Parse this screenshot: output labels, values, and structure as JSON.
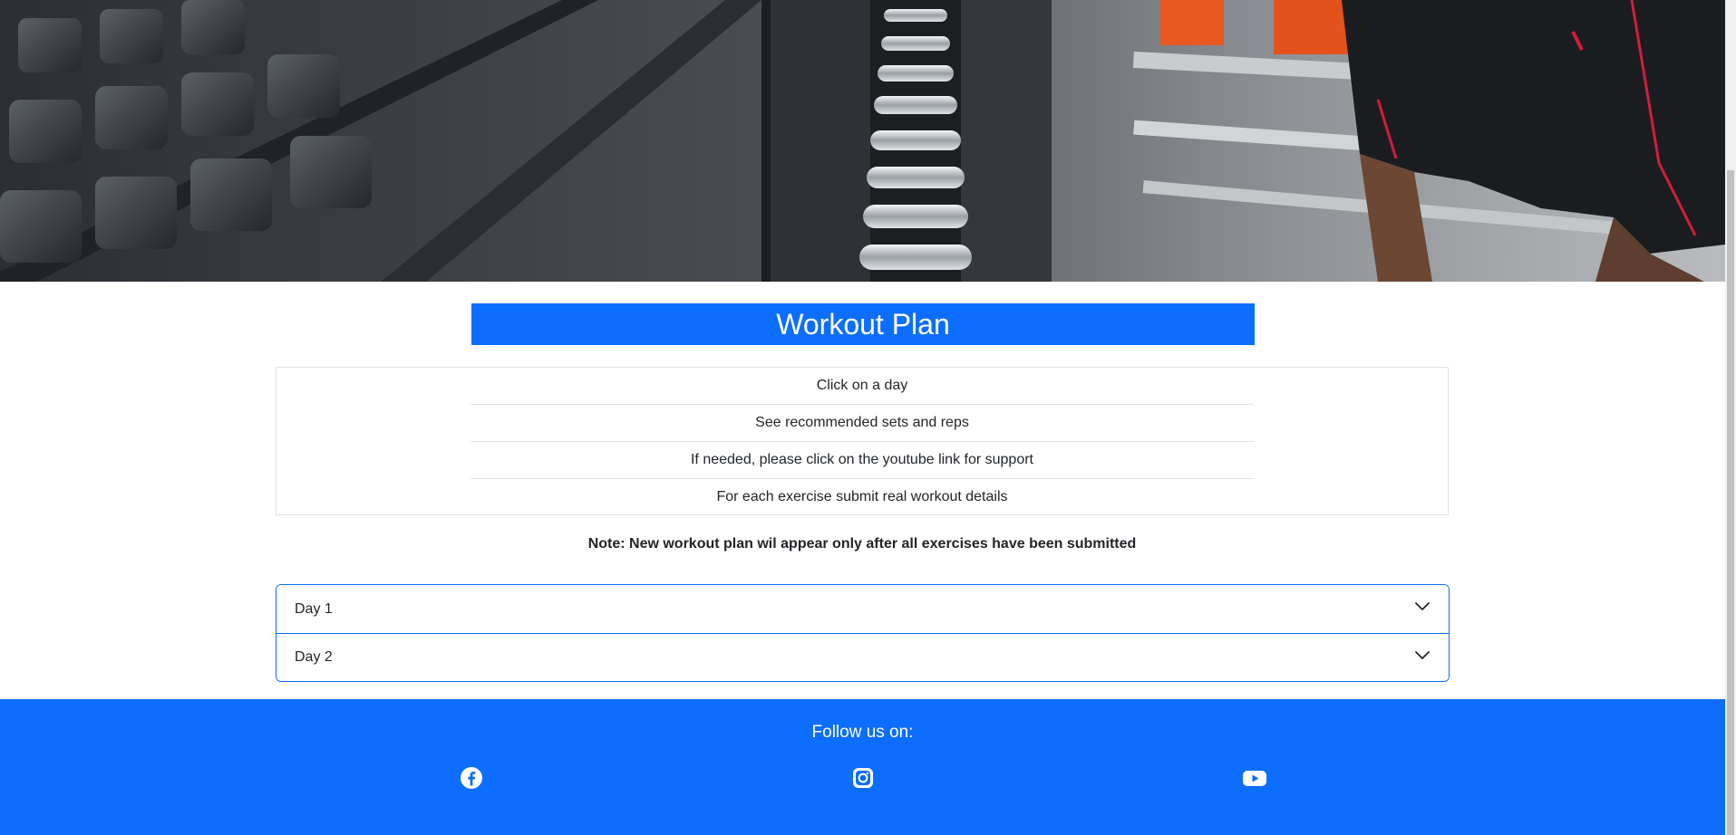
{
  "hero": {
    "image": "gym-dumbbell-rack-photo"
  },
  "header": {
    "title": "Workout Plan"
  },
  "instructions": {
    "items": [
      "Click on a day",
      "See recommended sets and reps",
      "If needed, please click on the youtube link for support",
      "For each exercise submit real workout details"
    ]
  },
  "note": "Note: New workout plan wil appear only after all exercises have been submitted",
  "accordion": {
    "items": [
      {
        "label": "Day 1",
        "icon": "chevron-down-icon"
      },
      {
        "label": "Day 2",
        "icon": "chevron-down-icon"
      }
    ]
  },
  "footer": {
    "follow_label": "Follow us on:",
    "social": [
      {
        "name": "facebook-icon"
      },
      {
        "name": "instagram-icon"
      },
      {
        "name": "youtube-icon"
      }
    ]
  },
  "colors": {
    "primary": "#0d6efd",
    "border": "#dee2e6",
    "text": "#212529"
  }
}
